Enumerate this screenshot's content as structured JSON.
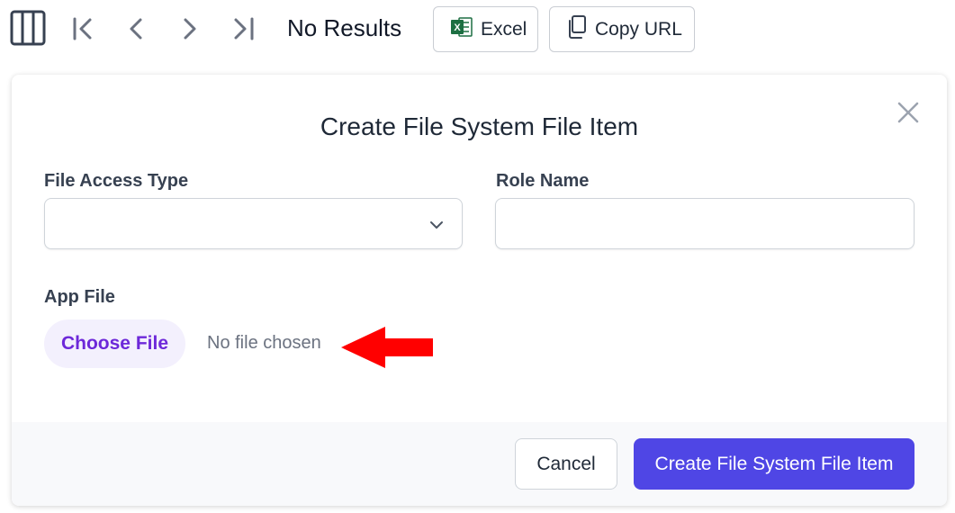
{
  "toolbar": {
    "columns_icon": "columns-icon",
    "first_icon": "first-page-icon",
    "prev_icon": "chevron-left-icon",
    "next_icon": "chevron-right-icon",
    "last_icon": "last-page-icon",
    "results_text": "No Results",
    "excel_label": "Excel",
    "excel_icon": "excel-icon",
    "excel_color": "#1d6f42",
    "copy_url_label": "Copy URL",
    "copy_icon": "copy-icon"
  },
  "modal": {
    "title": "Create File System File Item",
    "close_icon": "close-icon",
    "fields": {
      "file_access_type": {
        "label": "File Access Type",
        "value": ""
      },
      "role_name": {
        "label": "Role Name",
        "value": "",
        "placeholder": ""
      },
      "app_file": {
        "label": "App File",
        "choose_label": "Choose File",
        "status": "No file chosen"
      }
    },
    "footer": {
      "cancel_label": "Cancel",
      "submit_label": "Create File System File Item"
    }
  },
  "annotation": {
    "icon": "red-arrow-icon",
    "color": "#ff0000"
  },
  "colors": {
    "accent": "#4f46e5",
    "choose_file_bg": "#f3f0fd",
    "choose_file_text": "#6d28d9"
  }
}
